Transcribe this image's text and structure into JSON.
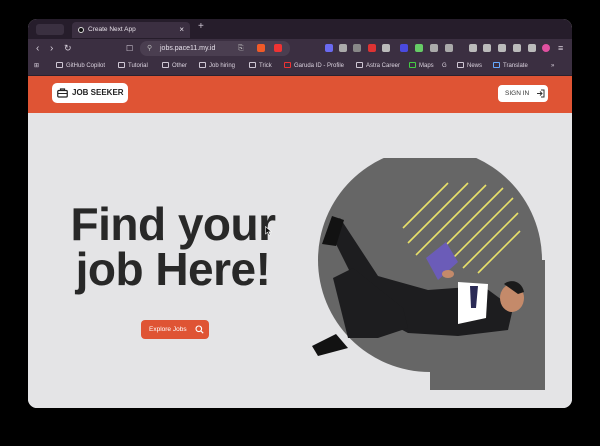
{
  "browser": {
    "tab_title": "Create Next App",
    "url": "jobs.pace11.my.id",
    "bookmarks": [
      "GitHub Copilot",
      "Tutorial",
      "Other",
      "Job hiring",
      "Trick",
      "Garuda ID - Profile",
      "Astra Career",
      "Maps",
      "News",
      "Translate"
    ]
  },
  "header": {
    "logo_text": "JOB SEEKER",
    "signin_label": "SIGN IN"
  },
  "hero": {
    "headline_line1": "Find your",
    "headline_line2": "job Here!",
    "cta_label": "Explore Jobs"
  },
  "colors": {
    "accent": "#df5434",
    "background": "#e4e4e6",
    "circle": "#666666",
    "stripes": "#e8e06a"
  }
}
